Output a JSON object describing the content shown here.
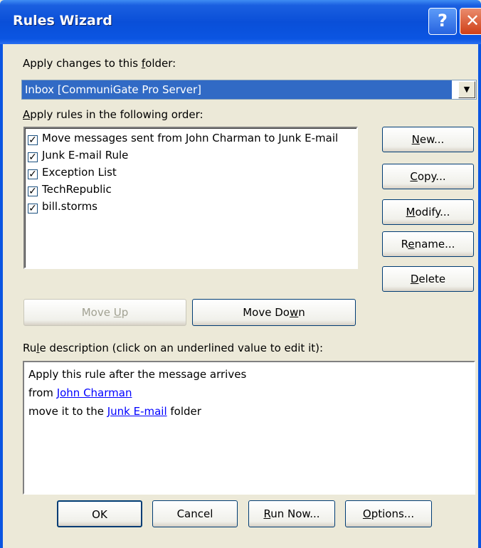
{
  "window": {
    "title": "Rules Wizard",
    "help_glyph": "?",
    "close_glyph": "✕"
  },
  "folder": {
    "label_before": "Apply changes to this ",
    "label_mnemonic": "f",
    "label_after": "older:",
    "selected": "Inbox [CommuniGate Pro Server]",
    "arrow_glyph": "▼"
  },
  "rules": {
    "label_mnemonic": "A",
    "label_after": "pply rules in the following order:",
    "check_glyph": "✓",
    "items": [
      {
        "label": "Move messages sent from John Charman to Junk E-mail",
        "checked": true
      },
      {
        "label": "Junk E-mail Rule",
        "checked": true
      },
      {
        "label": "Exception List",
        "checked": true
      },
      {
        "label": "TechRepublic",
        "checked": true
      },
      {
        "label": "bill.storms",
        "checked": true
      }
    ]
  },
  "side_buttons": {
    "new": {
      "mn": "N",
      "rest": "ew..."
    },
    "copy": {
      "mn": "C",
      "rest": "opy..."
    },
    "modify": {
      "mn": "M",
      "rest": "odify..."
    },
    "rename": {
      "pre": "R",
      "mn": "e",
      "rest": "name..."
    },
    "delete": {
      "mn": "D",
      "rest": "elete"
    }
  },
  "order_buttons": {
    "move_up": {
      "pre": "Move ",
      "mn": "U",
      "rest": "p"
    },
    "move_down": {
      "pre": "Move Do",
      "mn": "w",
      "rest": "n"
    }
  },
  "description": {
    "label_pre": "Ru",
    "label_mnemonic": "l",
    "label_rest": "e description (click on an underlined value to edit it):",
    "line1": "Apply this rule after the message arrives",
    "line2_prefix": "from ",
    "line2_link": "John Charman",
    "line3_prefix": "move it to the ",
    "line3_link": "Junk E-mail",
    "line3_suffix": " folder"
  },
  "bottom_buttons": {
    "ok": "OK",
    "cancel": "Cancel",
    "run_now": {
      "mn": "R",
      "rest": "un Now..."
    },
    "options": {
      "mn": "O",
      "rest": "ptions..."
    }
  }
}
